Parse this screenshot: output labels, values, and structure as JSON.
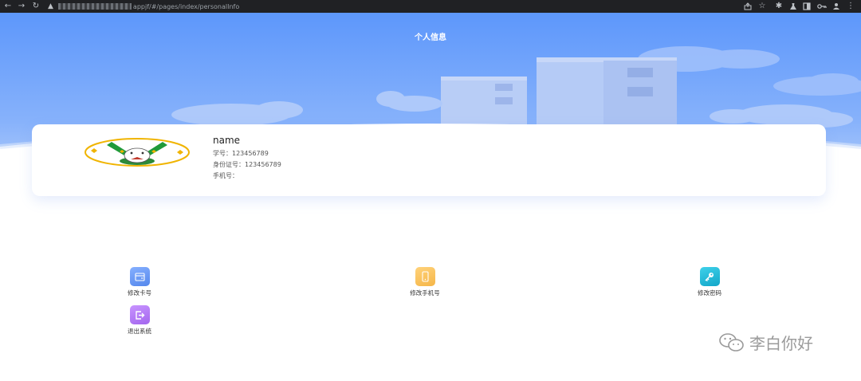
{
  "browser": {
    "url_path": "appjf/#/pages/index/personalInfo",
    "icons": [
      "back-icon",
      "forward-icon",
      "reload-icon",
      "warning-icon",
      "share-icon",
      "star-icon",
      "extensions-icon",
      "lab-icon",
      "sidepanel-icon",
      "key-icon",
      "profile-icon",
      "menu-icon"
    ]
  },
  "page": {
    "title": "个人信息"
  },
  "profile": {
    "name": "name",
    "student_id": "学号：123456789",
    "id_card": "身份证号：123456789",
    "phone": "手机号："
  },
  "menu": [
    {
      "label": "修改卡号",
      "icon": "card-icon",
      "color": "#6b9af2"
    },
    {
      "label": "修改手机号",
      "icon": "phone-icon",
      "color": "#f7c15e"
    },
    {
      "label": "修改密码",
      "icon": "key-icon",
      "color": "#1ab6d6"
    },
    {
      "label": "退出系统",
      "icon": "logout-icon",
      "color": "#b779f0"
    }
  ],
  "watermark": {
    "text": "李白你好",
    "icon": "wechat-icon"
  },
  "colors": {
    "header_blue": "#5d97fb",
    "accent": "#6b9af2"
  }
}
